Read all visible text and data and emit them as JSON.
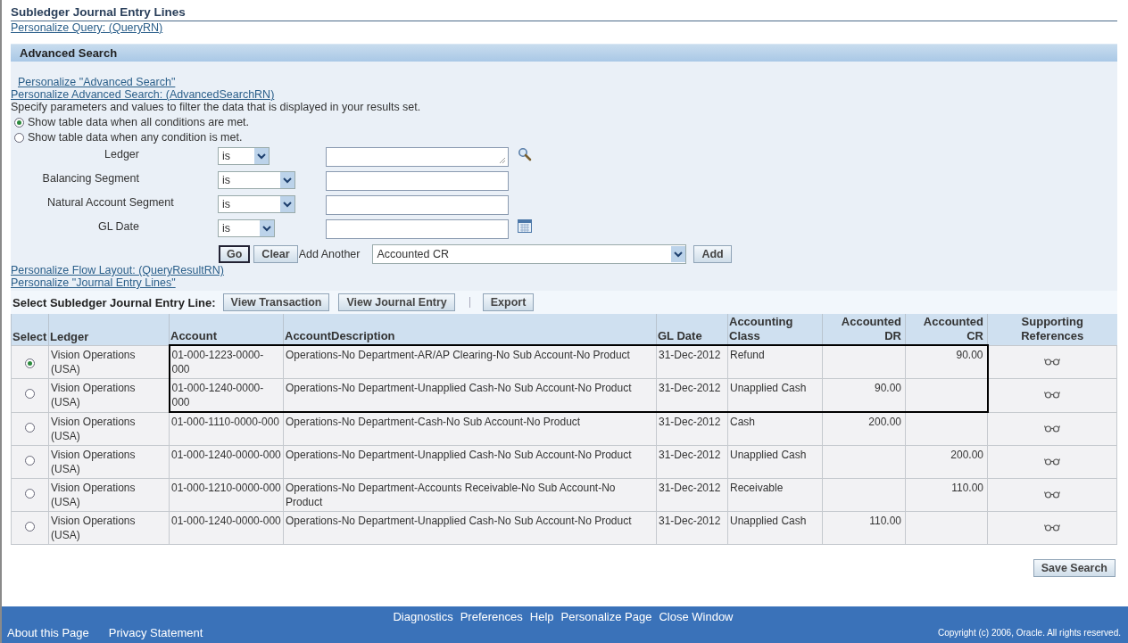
{
  "page_title": "Subledger Journal Entry Lines",
  "personalize_query_link": "Personalize Query: (QueryRN)",
  "advanced_search": {
    "header": "Advanced Search",
    "links": [
      "Personalize \"Advanced Search\"",
      "Personalize Advanced Search: (AdvancedSearchRN)"
    ],
    "instructions": "Specify parameters and values to filter the data that is displayed in your results set.",
    "match_options": [
      {
        "label": "Show table data when all conditions are met.",
        "selected": true
      },
      {
        "label": "Show table data when any condition is met.",
        "selected": false
      }
    ],
    "conditions": [
      {
        "label": "Ledger",
        "operator": "is",
        "kind": "lookup"
      },
      {
        "label": "Balancing Segment",
        "operator": "is",
        "kind": "text"
      },
      {
        "label": "Natural Account Segment",
        "operator": "is",
        "kind": "text"
      },
      {
        "label": "GL Date",
        "operator": "is",
        "kind": "date"
      }
    ],
    "go_button": "Go",
    "clear_button": "Clear",
    "add_another_label": "Add Another",
    "add_another_value": "Accounted CR",
    "add_button": "Add"
  },
  "result_links": [
    "Personalize Flow Layout: (QueryResultRN)",
    "Personalize \"Journal Entry Lines\""
  ],
  "table": {
    "toolbar_label": "Select Subledger Journal Entry Line:",
    "toolbar_buttons": [
      "View Transaction",
      "View Journal Entry",
      "Export"
    ],
    "columns": [
      "Select",
      "Ledger",
      "Account",
      "AccountDescription",
      "GL Date",
      "Accounting Class",
      "Accounted DR",
      "Accounted CR",
      "Supporting References"
    ],
    "rows": [
      {
        "selected": true,
        "highlighted": true,
        "ledger": "Vision Operations (USA)",
        "account": "01-000-1223-0000-000",
        "description": "Operations-No Department-AR/AP Clearing-No Sub Account-No Product",
        "gl_date": "31-Dec-2012",
        "accounting_class": "Refund",
        "dr": "",
        "cr": "90.00"
      },
      {
        "selected": false,
        "highlighted": true,
        "ledger": "Vision Operations (USA)",
        "account": "01-000-1240-0000-000",
        "description": "Operations-No Department-Unapplied Cash-No Sub Account-No Product",
        "gl_date": "31-Dec-2012",
        "accounting_class": "Unapplied Cash",
        "dr": "90.00",
        "cr": ""
      },
      {
        "selected": false,
        "highlighted": false,
        "ledger": "Vision Operations (USA)",
        "account": "01-000-1110-0000-000",
        "description": "Operations-No Department-Cash-No Sub Account-No Product",
        "gl_date": "31-Dec-2012",
        "accounting_class": "Cash",
        "dr": "200.00",
        "cr": ""
      },
      {
        "selected": false,
        "highlighted": false,
        "ledger": "Vision Operations (USA)",
        "account": "01-000-1240-0000-000",
        "description": "Operations-No Department-Unapplied Cash-No Sub Account-No Product",
        "gl_date": "31-Dec-2012",
        "accounting_class": "Unapplied Cash",
        "dr": "",
        "cr": "200.00"
      },
      {
        "selected": false,
        "highlighted": false,
        "ledger": "Vision Operations (USA)",
        "account": "01-000-1210-0000-000",
        "description": "Operations-No Department-Accounts Receivable-No Sub Account-No Product",
        "gl_date": "31-Dec-2012",
        "accounting_class": "Receivable",
        "dr": "",
        "cr": "110.00"
      },
      {
        "selected": false,
        "highlighted": false,
        "ledger": "Vision Operations (USA)",
        "account": "01-000-1240-0000-000",
        "description": "Operations-No Department-Unapplied Cash-No Sub Account-No Product",
        "gl_date": "31-Dec-2012",
        "accounting_class": "Unapplied Cash",
        "dr": "110.00",
        "cr": ""
      }
    ]
  },
  "save_search_button": "Save Search",
  "footer": {
    "links": [
      "Diagnostics",
      "Preferences",
      "Help",
      "Personalize Page",
      "Close Window"
    ],
    "bottom_links": [
      "About this Page",
      "Privacy Statement"
    ],
    "copyright": "Copyright (c) 2006, Oracle. All rights reserved."
  }
}
